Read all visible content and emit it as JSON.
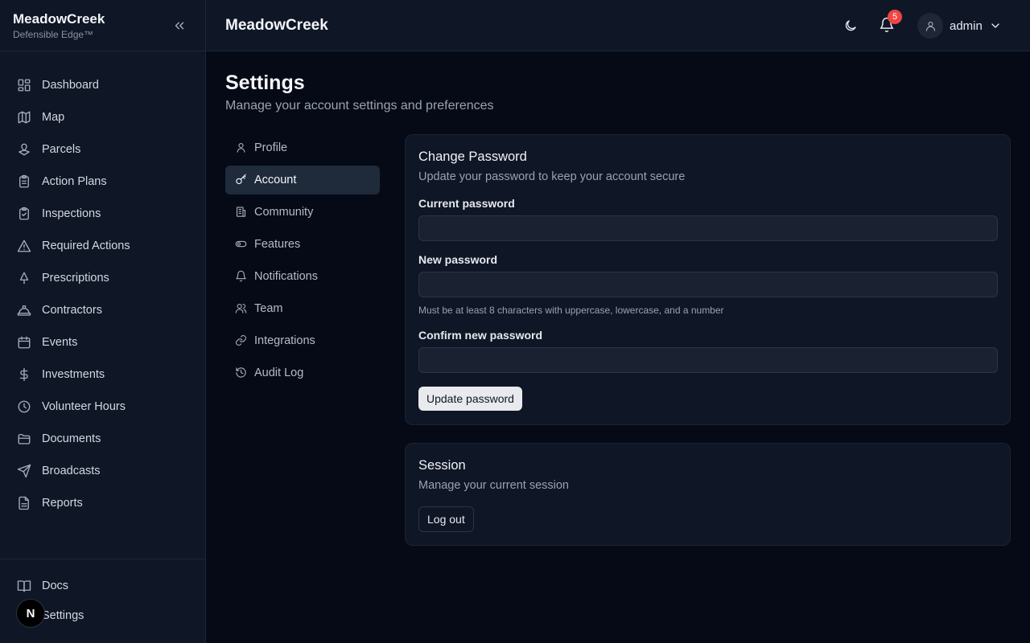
{
  "brand": {
    "name": "MeadowCreek",
    "tagline": "Defensible Edge™"
  },
  "sidebar": {
    "items": [
      {
        "label": "Dashboard",
        "icon": "dashboard-icon"
      },
      {
        "label": "Map",
        "icon": "map-icon"
      },
      {
        "label": "Parcels",
        "icon": "parcels-icon"
      },
      {
        "label": "Action Plans",
        "icon": "clipboard-list-icon"
      },
      {
        "label": "Inspections",
        "icon": "clipboard-check-icon"
      },
      {
        "label": "Required Actions",
        "icon": "alert-triangle-icon"
      },
      {
        "label": "Prescriptions",
        "icon": "tree-icon"
      },
      {
        "label": "Contractors",
        "icon": "hard-hat-icon"
      },
      {
        "label": "Events",
        "icon": "calendar-icon"
      },
      {
        "label": "Investments",
        "icon": "dollar-icon"
      },
      {
        "label": "Volunteer Hours",
        "icon": "clock-icon"
      },
      {
        "label": "Documents",
        "icon": "folder-icon"
      },
      {
        "label": "Broadcasts",
        "icon": "send-icon"
      },
      {
        "label": "Reports",
        "icon": "file-text-icon"
      }
    ],
    "bottom_items": [
      {
        "label": "Docs",
        "icon": "book-icon"
      },
      {
        "label": "Settings",
        "icon": "settings-icon"
      }
    ],
    "dev_badge": "N"
  },
  "header": {
    "title": "MeadowCreek",
    "notification_count": "5",
    "user_name": "admin"
  },
  "page": {
    "title": "Settings",
    "subtitle": "Manage your account settings and preferences"
  },
  "settings_nav": {
    "items": [
      {
        "label": "Profile",
        "icon": "user-icon",
        "active": false
      },
      {
        "label": "Account",
        "icon": "key-icon",
        "active": true
      },
      {
        "label": "Community",
        "icon": "building-icon",
        "active": false
      },
      {
        "label": "Features",
        "icon": "toggle-icon",
        "active": false
      },
      {
        "label": "Notifications",
        "icon": "bell-icon",
        "active": false
      },
      {
        "label": "Team",
        "icon": "users-icon",
        "active": false
      },
      {
        "label": "Integrations",
        "icon": "link-icon",
        "active": false
      },
      {
        "label": "Audit Log",
        "icon": "history-icon",
        "active": false
      }
    ]
  },
  "password_card": {
    "title": "Change Password",
    "description": "Update your password to keep your account secure",
    "current_label": "Current password",
    "current_value": "",
    "new_label": "New password",
    "new_value": "",
    "new_hint": "Must be at least 8 characters with uppercase, lowercase, and a number",
    "confirm_label": "Confirm new password",
    "confirm_value": "",
    "submit_label": "Update password"
  },
  "session_card": {
    "title": "Session",
    "description": "Manage your current session",
    "logout_label": "Log out"
  },
  "colors": {
    "background": "#050a16",
    "panel": "#0f1626",
    "active_nav": "#1f2a3b",
    "badge": "#ef4444"
  }
}
